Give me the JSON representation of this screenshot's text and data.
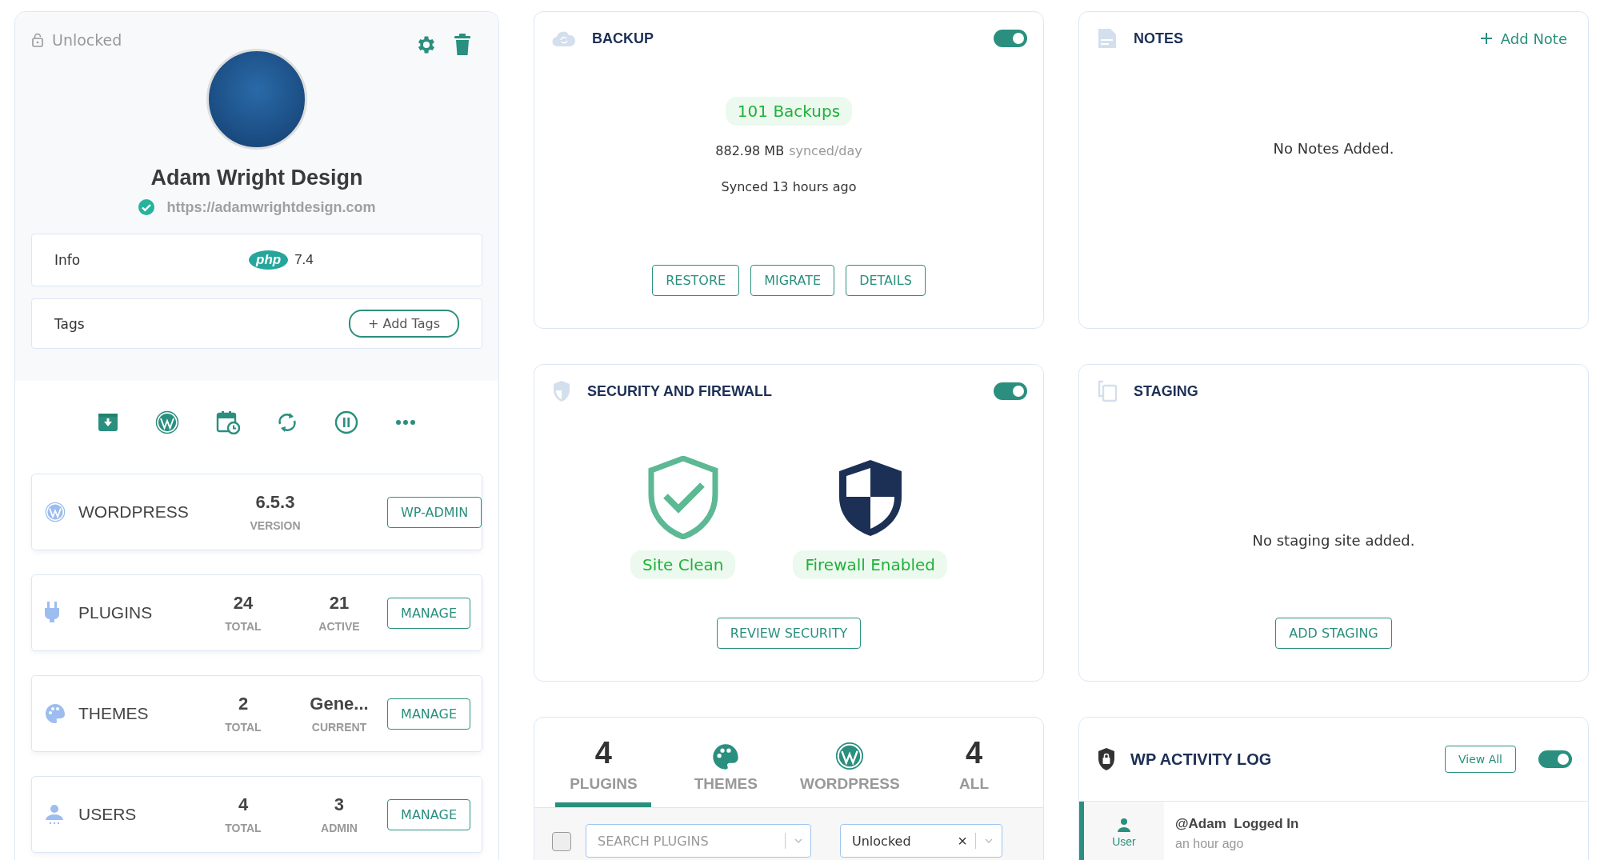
{
  "site": {
    "lock_label": "Unlocked",
    "locked": false,
    "name": "Adam Wright Design",
    "url": "https://adamwrightdesign.com",
    "verified": true,
    "info_label": "Info",
    "php_badge": "php",
    "php_version": "7.4",
    "tags_label": "Tags",
    "add_tags": "+ Add Tags"
  },
  "stats": [
    {
      "kind": "wordpress",
      "title": "WORDPRESS",
      "values": [
        {
          "value": "6.5.3",
          "label": "VERSION"
        }
      ],
      "button": "WP-ADMIN"
    },
    {
      "kind": "plugins",
      "title": "PLUGINS",
      "values": [
        {
          "value": "24",
          "label": "TOTAL"
        },
        {
          "value": "21",
          "label": "ACTIVE"
        }
      ],
      "button": "MANAGE"
    },
    {
      "kind": "themes",
      "title": "THEMES",
      "values": [
        {
          "value": "2",
          "label": "TOTAL"
        },
        {
          "value": "Gene...",
          "label": "CURRENT"
        }
      ],
      "button": "MANAGE"
    },
    {
      "kind": "users",
      "title": "USERS",
      "values": [
        {
          "value": "4",
          "label": "TOTAL"
        },
        {
          "value": "3",
          "label": "ADMIN"
        }
      ],
      "button": "MANAGE"
    }
  ],
  "backup": {
    "title": "BACKUP",
    "enabled": true,
    "count": "101 Backups",
    "size": "882.98 MB",
    "size_unit": "synced/day",
    "synced": "Synced 13 hours ago",
    "buttons": [
      "RESTORE",
      "MIGRATE",
      "DETAILS"
    ]
  },
  "notes": {
    "title": "NOTES",
    "add": "Add Note",
    "empty": "No Notes Added."
  },
  "security": {
    "title": "SECURITY AND FIREWALL",
    "enabled": true,
    "items": [
      {
        "kind": "clean",
        "label": "Site Clean"
      },
      {
        "kind": "firewall",
        "label": "Firewall Enabled"
      }
    ],
    "button": "REVIEW SECURITY"
  },
  "staging": {
    "title": "STAGING",
    "empty": "No staging site added.",
    "button": "ADD STAGING"
  },
  "updates": {
    "tabs": [
      {
        "kind": "count",
        "count": "4",
        "label": "PLUGINS",
        "selected": true
      },
      {
        "kind": "themes",
        "label": "THEMES",
        "selected": false
      },
      {
        "kind": "wordpress",
        "label": "WORDPRESS",
        "selected": false
      },
      {
        "kind": "count",
        "count": "4",
        "label": "ALL",
        "selected": false
      }
    ],
    "select_all": false,
    "search": {
      "placeholder": "SEARCH PLUGINS"
    },
    "filter": {
      "value": "Unlocked",
      "clear": "×"
    }
  },
  "activity": {
    "title": "WP ACTIVITY LOG",
    "view_all": "View All",
    "enabled": true,
    "entries": [
      {
        "role": "User",
        "user": "@Adam",
        "action": "Logged In",
        "time": "an hour ago"
      }
    ]
  }
}
